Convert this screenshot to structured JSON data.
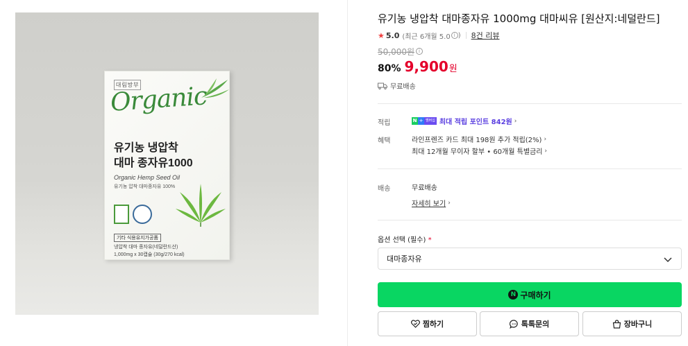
{
  "product": {
    "title": "유기농 냉압착 대마종자유 1000mg 대마씨유 [원산지:네덜란드]",
    "rating": "5.0",
    "rating_recent": "(최근 6개월 5.0",
    "rating_recent_close": ")",
    "review_link": "8건 리뷰",
    "original_price": "50,000원",
    "discount": "80%",
    "price": "9,900",
    "price_unit": "원",
    "shipping": "무료배송"
  },
  "image_text": {
    "brand": "대림방부",
    "script": "Organic",
    "title_line1": "유기농 냉압착",
    "title_line2": "대마 종자유1000",
    "eng": "Organic Hemp Seed Oil",
    "kor": "유기농 압착 대마종자유 100%",
    "tag": "기타 식용유지가공품",
    "line1": "냉압착 대마 종자유(네덜란드산)",
    "line2": "1,000mg x 30캡슐 (30g/270 kcal)"
  },
  "details": {
    "points_label": "적립",
    "npay_n": "N",
    "npay_plus": "+",
    "npay_member": "멤버십",
    "points_value": "최대 적립 포인트 842원",
    "benefit_label": "혜택",
    "benefit_line1": "라인프렌즈 카드 최대 198원 추가 적립(2%)",
    "benefit_line2": "최대 12개월 무이자 할부 • 60개월 특별금리",
    "delivery_label": "배송",
    "delivery_value": "무료배송",
    "detail_link": "자세히 보기"
  },
  "option": {
    "label": "옵션 선택 (필수)",
    "required_mark": "*",
    "selected": "대마종자유"
  },
  "actions": {
    "buy_icon_letter": "N",
    "buy": "구매하기",
    "wish": "찜하기",
    "talk": "톡톡문의",
    "cart": "장바구니"
  },
  "colors": {
    "accent_green": "#09d662",
    "price_red": "#e4002b",
    "point_purple": "#5a3ee0"
  }
}
